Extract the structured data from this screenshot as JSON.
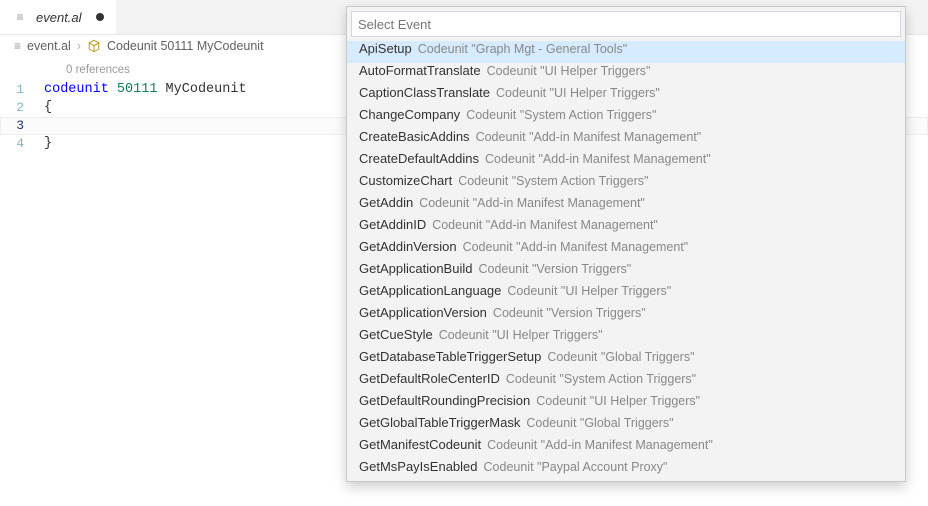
{
  "tab": {
    "title": "event.al",
    "dirty": true
  },
  "breadcrumb": {
    "file": "event.al",
    "symbol": "Codeunit 50111 MyCodeunit"
  },
  "codelens": "0 references",
  "code": {
    "lines": [
      {
        "n": "1",
        "tokens": [
          {
            "t": "kw",
            "v": "codeunit"
          },
          {
            "t": "plain",
            "v": " "
          },
          {
            "t": "num",
            "v": "50111"
          },
          {
            "t": "plain",
            "v": " MyCodeunit"
          }
        ]
      },
      {
        "n": "2",
        "tokens": [
          {
            "t": "plain",
            "v": "{"
          }
        ]
      },
      {
        "n": "3",
        "tokens": [
          {
            "t": "plain",
            "v": "    "
          }
        ],
        "current": true
      },
      {
        "n": "4",
        "tokens": [
          {
            "t": "plain",
            "v": "}"
          }
        ]
      }
    ]
  },
  "quickopen": {
    "placeholder": "Select Event",
    "value": "",
    "items": [
      {
        "name": "ApiSetup",
        "detail": "Codeunit \"Graph Mgt - General Tools\"",
        "selected": true
      },
      {
        "name": "AutoFormatTranslate",
        "detail": "Codeunit \"UI Helper Triggers\""
      },
      {
        "name": "CaptionClassTranslate",
        "detail": "Codeunit \"UI Helper Triggers\""
      },
      {
        "name": "ChangeCompany",
        "detail": "Codeunit \"System Action Triggers\""
      },
      {
        "name": "CreateBasicAddins",
        "detail": "Codeunit \"Add-in Manifest Management\""
      },
      {
        "name": "CreateDefaultAddins",
        "detail": "Codeunit \"Add-in Manifest Management\""
      },
      {
        "name": "CustomizeChart",
        "detail": "Codeunit \"System Action Triggers\""
      },
      {
        "name": "GetAddin",
        "detail": "Codeunit \"Add-in Manifest Management\""
      },
      {
        "name": "GetAddinID",
        "detail": "Codeunit \"Add-in Manifest Management\""
      },
      {
        "name": "GetAddinVersion",
        "detail": "Codeunit \"Add-in Manifest Management\""
      },
      {
        "name": "GetApplicationBuild",
        "detail": "Codeunit \"Version Triggers\""
      },
      {
        "name": "GetApplicationLanguage",
        "detail": "Codeunit \"UI Helper Triggers\""
      },
      {
        "name": "GetApplicationVersion",
        "detail": "Codeunit \"Version Triggers\""
      },
      {
        "name": "GetCueStyle",
        "detail": "Codeunit \"UI Helper Triggers\""
      },
      {
        "name": "GetDatabaseTableTriggerSetup",
        "detail": "Codeunit \"Global Triggers\""
      },
      {
        "name": "GetDefaultRoleCenterID",
        "detail": "Codeunit \"System Action Triggers\""
      },
      {
        "name": "GetDefaultRoundingPrecision",
        "detail": "Codeunit \"UI Helper Triggers\""
      },
      {
        "name": "GetGlobalTableTriggerMask",
        "detail": "Codeunit \"Global Triggers\""
      },
      {
        "name": "GetManifestCodeunit",
        "detail": "Codeunit \"Add-in Manifest Management\""
      },
      {
        "name": "GetMsPayIsEnabled",
        "detail": "Codeunit \"Paypal Account Proxy\""
      }
    ]
  }
}
